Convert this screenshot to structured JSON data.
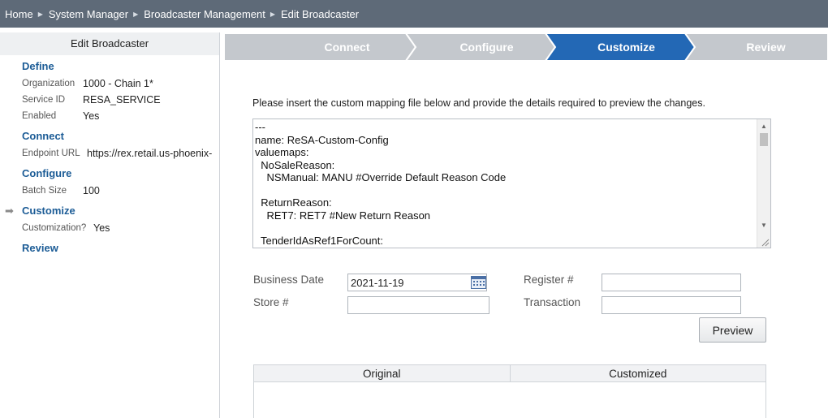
{
  "breadcrumb": [
    "Home",
    "System Manager",
    "Broadcaster Management",
    "Edit Broadcaster"
  ],
  "sidebar": {
    "title": "Edit Broadcaster",
    "sections": {
      "define": {
        "label": "Define",
        "organization_label": "Organization",
        "organization_value": "1000 - Chain 1*",
        "service_id_label": "Service ID",
        "service_id_value": "RESA_SERVICE",
        "enabled_label": "Enabled",
        "enabled_value": "Yes"
      },
      "connect": {
        "label": "Connect",
        "endpoint_label": "Endpoint URL",
        "endpoint_value": "https://rex.retail.us-phoenix-"
      },
      "configure": {
        "label": "Configure",
        "batch_label": "Batch Size",
        "batch_value": "100"
      },
      "customize": {
        "label": "Customize",
        "customization_label": "Customization?",
        "customization_value": "Yes",
        "current_arrow": "➡"
      },
      "review": {
        "label": "Review"
      }
    }
  },
  "train_stop": {
    "steps": [
      "Connect",
      "Configure",
      "Customize",
      "Review"
    ],
    "active_index": 2,
    "colors": {
      "active": "#2368b5",
      "inactive": "#c4c8cd"
    }
  },
  "main": {
    "instructions": "Please insert the custom mapping file below and provide the details required to preview the changes.",
    "mapping_text": "---\nname: ReSA-Custom-Config\nvaluemaps:\n  NoSaleReason:\n    NSManual: MANU #Override Default Reason Code\n\n  ReturnReason:\n    RET7: RET7 #New Return Reason\n\n  TenderIdAsRef1ForCount:",
    "business_date_label": "Business Date",
    "business_date_value": "2021-11-19",
    "store_label": "Store #",
    "store_value": "",
    "register_label": "Register #",
    "register_value": "",
    "transaction_label": "Transaction",
    "transaction_value": "",
    "preview_button": "Preview",
    "compare_columns": [
      "Original",
      "Customized"
    ]
  }
}
